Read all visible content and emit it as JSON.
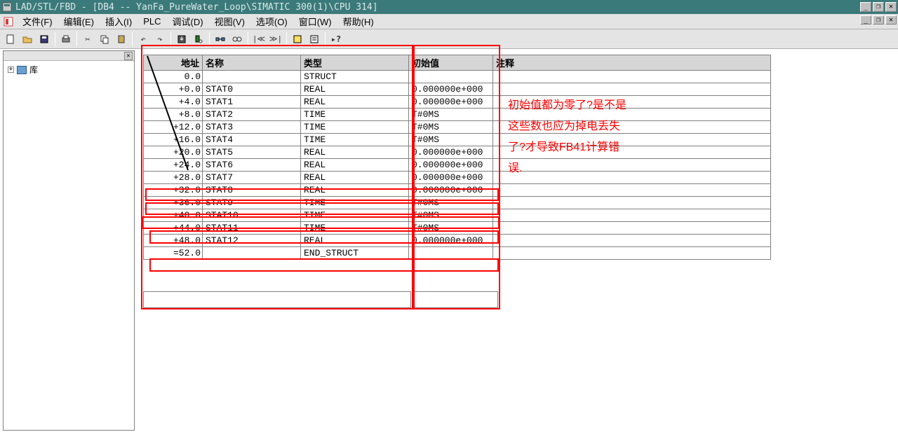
{
  "window": {
    "title": "LAD/STL/FBD  - [DB4 -- YanFa_PureWater_Loop\\SIMATIC 300(1)\\CPU 314]"
  },
  "menu": {
    "file": "文件(F)",
    "edit": "编辑(E)",
    "insert": "插入(I)",
    "plc": "PLC",
    "debug": "调试(D)",
    "view": "视图(V)",
    "options": "选项(O)",
    "window": "窗口(W)",
    "help": "帮助(H)"
  },
  "tree": {
    "root_label": "库",
    "expander": "+"
  },
  "table": {
    "headers": {
      "addr": "地址",
      "name": "名称",
      "type": "类型",
      "init": "初始值",
      "comment": "注释"
    },
    "rows": [
      {
        "addr": "0.0",
        "name": "",
        "type": "STRUCT",
        "init": "",
        "comment": ""
      },
      {
        "addr": "+0.0",
        "name": "STAT0",
        "type": "REAL",
        "init": "0.000000e+000",
        "comment": ""
      },
      {
        "addr": "+4.0",
        "name": "STAT1",
        "type": "REAL",
        "init": "0.000000e+000",
        "comment": ""
      },
      {
        "addr": "+8.0",
        "name": "STAT2",
        "type": "TIME",
        "init": "T#0MS",
        "comment": ""
      },
      {
        "addr": "+12.0",
        "name": "STAT3",
        "type": "TIME",
        "init": "T#0MS",
        "comment": ""
      },
      {
        "addr": "+16.0",
        "name": "STAT4",
        "type": "TIME",
        "init": "T#0MS",
        "comment": ""
      },
      {
        "addr": "+20.0",
        "name": "STAT5",
        "type": "REAL",
        "init": "0.000000e+000",
        "comment": ""
      },
      {
        "addr": "+24.0",
        "name": "STAT6",
        "type": "REAL",
        "init": "0.000000e+000",
        "comment": ""
      },
      {
        "addr": "+28.0",
        "name": "STAT7",
        "type": "REAL",
        "init": "0.000000e+000",
        "comment": ""
      },
      {
        "addr": "+32.0",
        "name": "STAT8",
        "type": "REAL",
        "init": "0.000000e+000",
        "comment": ""
      },
      {
        "addr": "+36.0",
        "name": "STAT9",
        "type": "TIME",
        "init": "T#0MS",
        "comment": ""
      },
      {
        "addr": "+40.0",
        "name": "STAT10",
        "type": "TIME",
        "init": "T#0MS",
        "comment": ""
      },
      {
        "addr": "+44.0",
        "name": "STAT11",
        "type": "TIME",
        "init": "T#0MS",
        "comment": ""
      },
      {
        "addr": "+48.0",
        "name": "STAT12",
        "type": "REAL",
        "init": "0.000000e+000",
        "comment": ""
      },
      {
        "addr": "=52.0",
        "name": "",
        "type": "END_STRUCT",
        "init": "",
        "comment": ""
      }
    ]
  },
  "annotation": {
    "line1": "初始值都为零了?是不是",
    "line2": "这些数也应为掉电丢失",
    "line3": "了?才导致FB41计算错",
    "line4": "误."
  }
}
